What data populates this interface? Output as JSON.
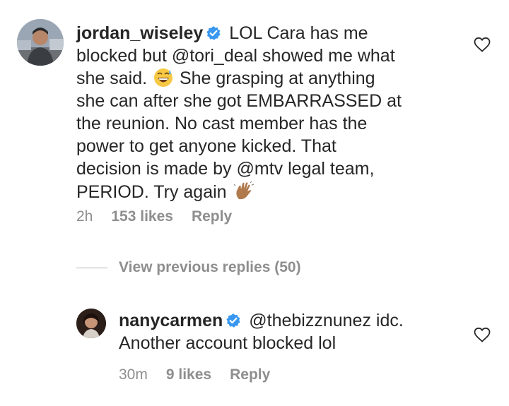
{
  "comments": [
    {
      "username": "jordan_wiseley",
      "verified": true,
      "text_parts": {
        "p1": "LOL Cara has me",
        "p2": "blocked but ",
        "mention1": "@tori_deal",
        "p3": " showed me what",
        "p4": "she said.",
        "p5": "She grasping at anything",
        "p6": "she can after she got EMBARRASSED at",
        "p7": "the reunion. No cast member has the",
        "p8": "power to get anyone kicked. That",
        "p9": "decision is made by ",
        "mention2": "@mtv",
        "p10": " legal team,",
        "p11": "PERIOD. Try again"
      },
      "emoji_1": "grinning-sweat-emoji",
      "emoji_2": "waving-hand-emoji",
      "time": "2h",
      "likes": "153 likes",
      "reply": "Reply"
    },
    {
      "username": "nanycarmen",
      "verified": true,
      "text_parts": {
        "mention1": "@thebizznunez",
        "p1": " idc.",
        "p2": "Another account blocked lol"
      },
      "time": "30m",
      "likes": "9 likes",
      "reply": "Reply"
    }
  ],
  "view_previous": "View previous replies (50)",
  "icons": {
    "heart": "heart-outline-icon",
    "verified": "verified-badge-icon"
  },
  "colors": {
    "text": "#262626",
    "muted": "#8e8e8e",
    "verified": "#3897f0"
  }
}
